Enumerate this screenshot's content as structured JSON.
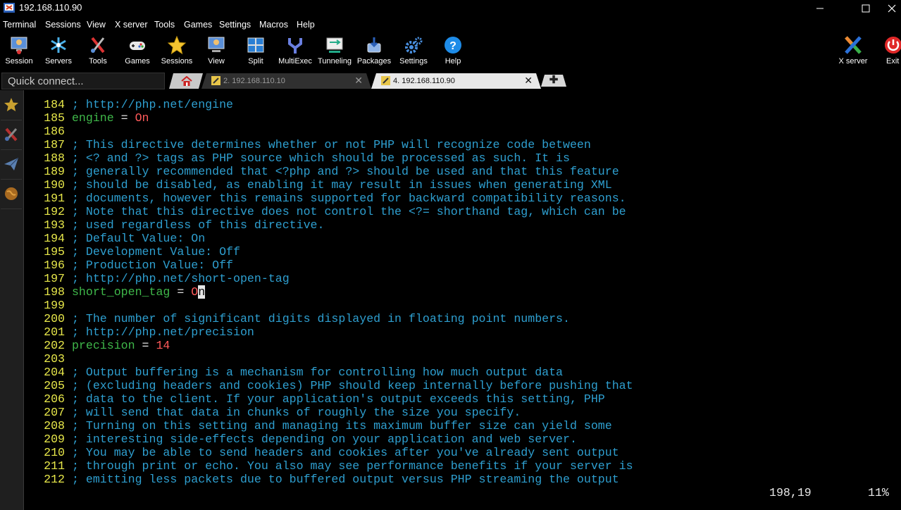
{
  "window": {
    "title": "192.168.110.90"
  },
  "menu": [
    "Terminal",
    "Sessions",
    "View",
    "X server",
    "Tools",
    "Games",
    "Settings",
    "Macros",
    "Help"
  ],
  "toolbar": {
    "items": [
      "Session",
      "Servers",
      "Tools",
      "Games",
      "Sessions",
      "View",
      "Split",
      "MultiExec",
      "Tunneling",
      "Packages",
      "Settings",
      "Help"
    ],
    "xserver": "X server",
    "exit": "Exit"
  },
  "quick_connect": {
    "placeholder": "Quick connect..."
  },
  "tabs": [
    {
      "label": "2. 192.168.110.10",
      "active": false
    },
    {
      "label": "4. 192.168.110.90",
      "active": true
    }
  ],
  "tab_close_glyph": "✕",
  "new_tab_glyph": "✚",
  "editor": {
    "lines": [
      {
        "n": "184",
        "type": "comment",
        "text": "; http://php.net/engine"
      },
      {
        "n": "185",
        "type": "setting",
        "key": "engine",
        "eq": " = ",
        "val": "On"
      },
      {
        "n": "186",
        "type": "blank",
        "text": ""
      },
      {
        "n": "187",
        "type": "comment",
        "text": "; This directive determines whether or not PHP will recognize code between"
      },
      {
        "n": "188",
        "type": "comment",
        "text": "; <? and ?> tags as PHP source which should be processed as such. It is"
      },
      {
        "n": "189",
        "type": "comment",
        "text": "; generally recommended that <?php and ?> should be used and that this feature"
      },
      {
        "n": "190",
        "type": "comment",
        "text": "; should be disabled, as enabling it may result in issues when generating XML"
      },
      {
        "n": "191",
        "type": "comment",
        "text": "; documents, however this remains supported for backward compatibility reasons."
      },
      {
        "n": "192",
        "type": "comment",
        "text": "; Note that this directive does not control the <?= shorthand tag, which can be"
      },
      {
        "n": "193",
        "type": "comment",
        "text": "; used regardless of this directive."
      },
      {
        "n": "194",
        "type": "comment",
        "text": "; Default Value: On"
      },
      {
        "n": "195",
        "type": "comment",
        "text": "; Development Value: Off"
      },
      {
        "n": "196",
        "type": "comment",
        "text": "; Production Value: Off"
      },
      {
        "n": "197",
        "type": "comment",
        "text": "; http://php.net/short-open-tag"
      },
      {
        "n": "198",
        "type": "setting",
        "key": "short_open_tag",
        "eq": " = ",
        "val": "O",
        "cursor": "n"
      },
      {
        "n": "199",
        "type": "blank",
        "text": ""
      },
      {
        "n": "200",
        "type": "comment",
        "text": "; The number of significant digits displayed in floating point numbers."
      },
      {
        "n": "201",
        "type": "comment",
        "text": "; http://php.net/precision"
      },
      {
        "n": "202",
        "type": "setting",
        "key": "precision",
        "eq": " = ",
        "val": "14"
      },
      {
        "n": "203",
        "type": "blank",
        "text": ""
      },
      {
        "n": "204",
        "type": "comment",
        "text": "; Output buffering is a mechanism for controlling how much output data"
      },
      {
        "n": "205",
        "type": "comment",
        "text": "; (excluding headers and cookies) PHP should keep internally before pushing that"
      },
      {
        "n": "206",
        "type": "comment",
        "text": "; data to the client. If your application's output exceeds this setting, PHP"
      },
      {
        "n": "207",
        "type": "comment",
        "text": "; will send that data in chunks of roughly the size you specify."
      },
      {
        "n": "208",
        "type": "comment",
        "text": "; Turning on this setting and managing its maximum buffer size can yield some"
      },
      {
        "n": "209",
        "type": "comment",
        "text": "; interesting side-effects depending on your application and web server."
      },
      {
        "n": "210",
        "type": "comment",
        "text": "; You may be able to send headers and cookies after you've already sent output"
      },
      {
        "n": "211",
        "type": "comment",
        "text": "; through print or echo. You also may see performance benefits if your server is"
      },
      {
        "n": "212",
        "type": "comment",
        "text": "; emitting less packets due to buffered output versus PHP streaming the output"
      }
    ],
    "status_position": "198,19",
    "status_percent": "11%"
  },
  "colors": {
    "line_number": "#e8e84a",
    "comment": "#2e9fd0",
    "key": "#3fb84a",
    "value": "#ff5a5a"
  }
}
